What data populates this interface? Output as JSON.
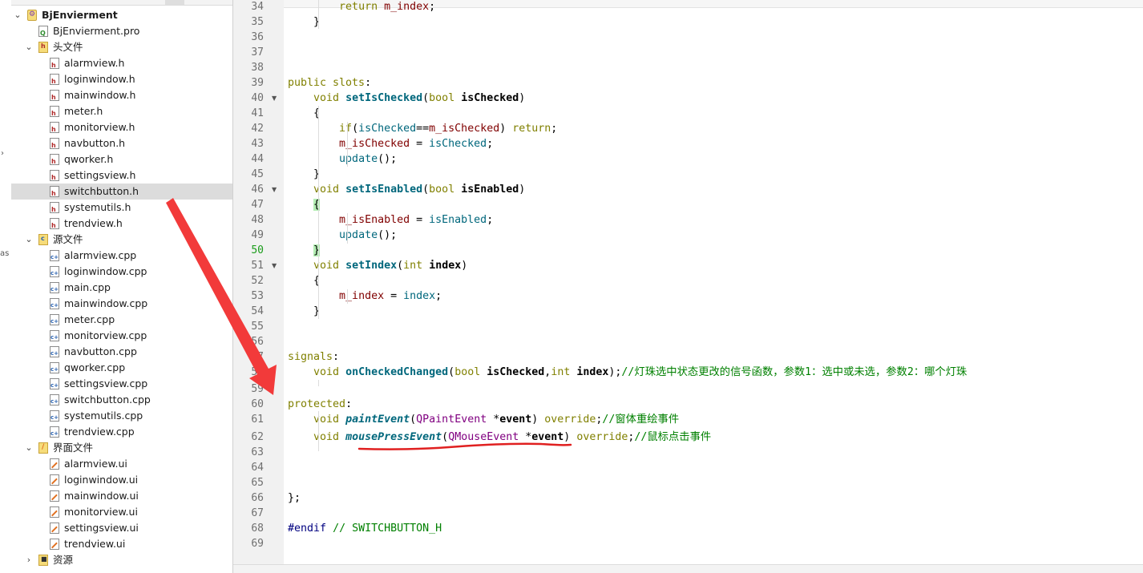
{
  "tree": {
    "project": "BjEnvierment",
    "pro_file": "BjEnvierment.pro",
    "headers_folder": "头文件",
    "headers": [
      "alarmview.h",
      "loginwindow.h",
      "mainwindow.h",
      "meter.h",
      "monitorview.h",
      "navbutton.h",
      "qworker.h",
      "settingsview.h",
      "switchbutton.h",
      "systemutils.h",
      "trendview.h"
    ],
    "selected_header": "switchbutton.h",
    "sources_folder": "源文件",
    "sources": [
      "alarmview.cpp",
      "loginwindow.cpp",
      "main.cpp",
      "mainwindow.cpp",
      "meter.cpp",
      "monitorview.cpp",
      "navbutton.cpp",
      "qworker.cpp",
      "settingsview.cpp",
      "switchbutton.cpp",
      "systemutils.cpp",
      "trendview.cpp"
    ],
    "forms_folder": "界面文件",
    "forms": [
      "alarmview.ui",
      "loginwindow.ui",
      "mainwindow.ui",
      "monitorview.ui",
      "settingsview.ui",
      "trendview.ui"
    ],
    "resources_folder": "资源"
  },
  "edge": {
    "fragment": "as"
  },
  "editor": {
    "current_line": "50",
    "lines": [
      {
        "n": "34",
        "fold": false,
        "html": "        <span class=\"kw\">return</span> <span class=\"mem\">m_index</span>;"
      },
      {
        "n": "35",
        "fold": false,
        "html": "    }"
      },
      {
        "n": "36",
        "fold": false,
        "html": ""
      },
      {
        "n": "37",
        "fold": false,
        "html": ""
      },
      {
        "n": "38",
        "fold": false,
        "html": ""
      },
      {
        "n": "39",
        "fold": false,
        "html": "<span class=\"kw\">public slots</span>:"
      },
      {
        "n": "40",
        "fold": true,
        "html": "    <span class=\"kw\">void</span> <span class=\"fnb\">setIsChecked</span>(<span class=\"kw\">bool</span> <span class=\"par\">isChecked</span>)"
      },
      {
        "n": "41",
        "fold": false,
        "html": "    {"
      },
      {
        "n": "42",
        "fold": false,
        "html": "        <span class=\"kw\">if</span>(<span class=\"fn\">isChecked</span>==<span class=\"mem\">m_isChecked</span>) <span class=\"kw\">return</span>;"
      },
      {
        "n": "43",
        "fold": false,
        "html": "        <span class=\"mem\">m_isChecked</span> = <span class=\"fn\">isChecked</span>;"
      },
      {
        "n": "44",
        "fold": false,
        "html": "        <span class=\"fn\">update</span>();"
      },
      {
        "n": "45",
        "fold": false,
        "html": "    }"
      },
      {
        "n": "46",
        "fold": true,
        "html": "    <span class=\"kw\">void</span> <span class=\"fnb\">setIsEnabled</span>(<span class=\"kw\">bool</span> <span class=\"par\">isEnabled</span>)"
      },
      {
        "n": "47",
        "fold": false,
        "html": "    <span class=\"brh\">{</span>"
      },
      {
        "n": "48",
        "fold": false,
        "html": "        <span class=\"mem\">m_isEnabled</span> = <span class=\"fn\">isEnabled</span>;"
      },
      {
        "n": "49",
        "fold": false,
        "html": "        <span class=\"fn\">update</span>();"
      },
      {
        "n": "50",
        "fold": false,
        "html": "    <span class=\"brh\">}</span>"
      },
      {
        "n": "51",
        "fold": true,
        "html": "    <span class=\"kw\">void</span> <span class=\"fnb\">setIndex</span>(<span class=\"kw\">int</span> <span class=\"par\">index</span>)"
      },
      {
        "n": "52",
        "fold": false,
        "html": "    {"
      },
      {
        "n": "53",
        "fold": false,
        "html": "        <span class=\"mem\">m_index</span> = <span class=\"fn\">index</span>;"
      },
      {
        "n": "54",
        "fold": false,
        "html": "    }"
      },
      {
        "n": "55",
        "fold": false,
        "html": ""
      },
      {
        "n": "56",
        "fold": false,
        "html": ""
      },
      {
        "n": "57",
        "fold": false,
        "html": "<span class=\"kw\">signals</span>:"
      },
      {
        "n": "58",
        "fold": false,
        "html": "    <span class=\"kw\">void</span> <span class=\"fnb\">onCheckedChanged</span>(<span class=\"kw\">bool</span> <span class=\"par\">isChecked</span>,<span class=\"kw\">int</span> <span class=\"par\">index</span>);<span class=\"cm\">//灯珠选中状态更改的信号函数，参数1：选中或未选，参数2：哪个灯珠</span>"
      },
      {
        "n": "59",
        "fold": false,
        "html": ""
      },
      {
        "n": "60",
        "fold": false,
        "html": "<span class=\"kw\">protected</span>:"
      },
      {
        "n": "61",
        "fold": false,
        "html": "    <span class=\"kw\">void</span> <span class=\"fni\">paintEvent</span>(<span class=\"ty\">QPaintEvent</span> *<span class=\"par\">event</span>) <span class=\"kw\">override</span>;<span class=\"cm\">//窗体重绘事件</span>"
      },
      {
        "n": "62",
        "fold": false,
        "html": "    <span class=\"kw\">void</span> <span class=\"fni\">mousePressEvent</span>(<span class=\"ty\">QMouseEvent</span> *<span class=\"par\">event</span>) <span class=\"kw\">override</span>;<span class=\"cm\">//鼠标点击事件</span>"
      },
      {
        "n": "63",
        "fold": false,
        "html": ""
      },
      {
        "n": "64",
        "fold": false,
        "html": ""
      },
      {
        "n": "65",
        "fold": false,
        "html": ""
      },
      {
        "n": "66",
        "fold": false,
        "html": "};"
      },
      {
        "n": "67",
        "fold": false,
        "html": ""
      },
      {
        "n": "68",
        "fold": false,
        "html": "<span class=\"pp\">#endif</span> <span class=\"cm\">// SWITCHBUTTON_H</span>"
      },
      {
        "n": "69",
        "fold": false,
        "html": ""
      }
    ]
  },
  "colors": {
    "arrow": "#f23a3a",
    "underline": "#e02020"
  }
}
